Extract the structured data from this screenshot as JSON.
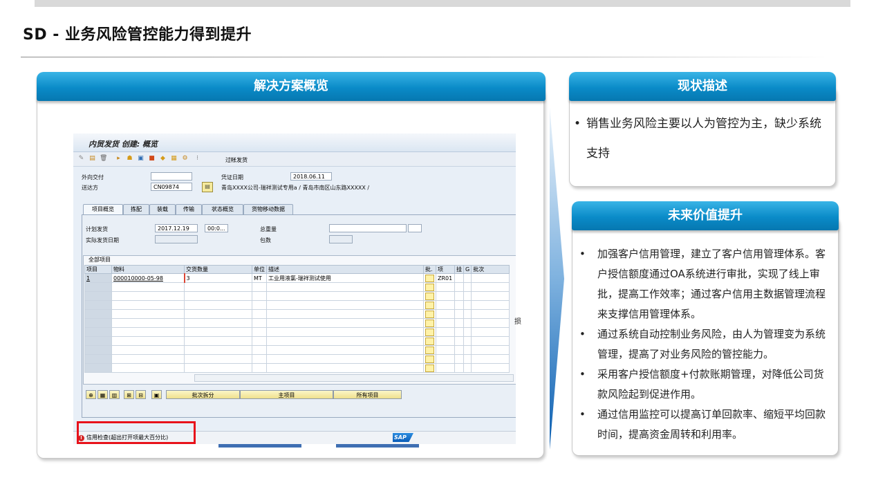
{
  "page_title": "SD - 业务风险管控能力得到提升",
  "left": {
    "header": "解决方案概览"
  },
  "status": {
    "header": "现状描述",
    "bullet": "销售业务风险主要以人为管控为主，缺少系统支持"
  },
  "future": {
    "header": "未来价值提升",
    "items": [
      "加强客户信用管理，建立了客户信用管理体系。客户授信额度通过OA系统进行审批，实现了线上审批，提高工作效率；通过客户信用主数据管理流程来支撑信用管理体系。",
      "通过系统自动控制业务风险，由人为管理变为系统管理，提高了对业务风险的管控能力。",
      "采用客户授信额度+付款账期管理，对降低公司货款风险起到促进作用。",
      "通过信用监控可以提高订单回款率、缩短平均回款时间，提高资金周转和利用率。"
    ]
  },
  "sap": {
    "title": "内贸发货 创建: 概览",
    "toolbar_text": "过帐发货",
    "external_delivery_label": "外向交付",
    "doc_date_label": "凭证日期",
    "doc_date": "2018.06.11",
    "ship_to_label": "送达方",
    "ship_to": "CN09874",
    "ship_to_desc": "青岛XXXX公司-瑞祥测试专用a / 青岛市南区山东路XXXXX /",
    "tabs": [
      "项目概览",
      "拣配",
      "装载",
      "传输",
      "状态概览",
      "货物移动数据"
    ],
    "planned_gi_label": "计划发货",
    "planned_gi_date": "2017.12.19",
    "planned_gi_time": "00:0...",
    "actual_gi_label": "实际发货日期",
    "total_weight_label": "总重量",
    "packages_label": "包数",
    "grid_title": "全部项目",
    "columns": [
      "项目",
      "物料",
      "交货数量",
      "单位",
      "描述",
      "批.",
      "项",
      "挂",
      "G",
      "批次"
    ],
    "row": {
      "item": "1",
      "material": "000010000-05-98",
      "qty": "3",
      "unit": "MT",
      "desc": "工业用液氯-瑞祥测试使用",
      "cat": "ZR01"
    },
    "buttons": {
      "batch_split": "批次拆分",
      "main_item": "主项目",
      "all_items": "所有项目"
    },
    "status_message": "信用检查(超出打开项最大百分比)",
    "sap_logo": "SAP",
    "stray_text": "损"
  }
}
